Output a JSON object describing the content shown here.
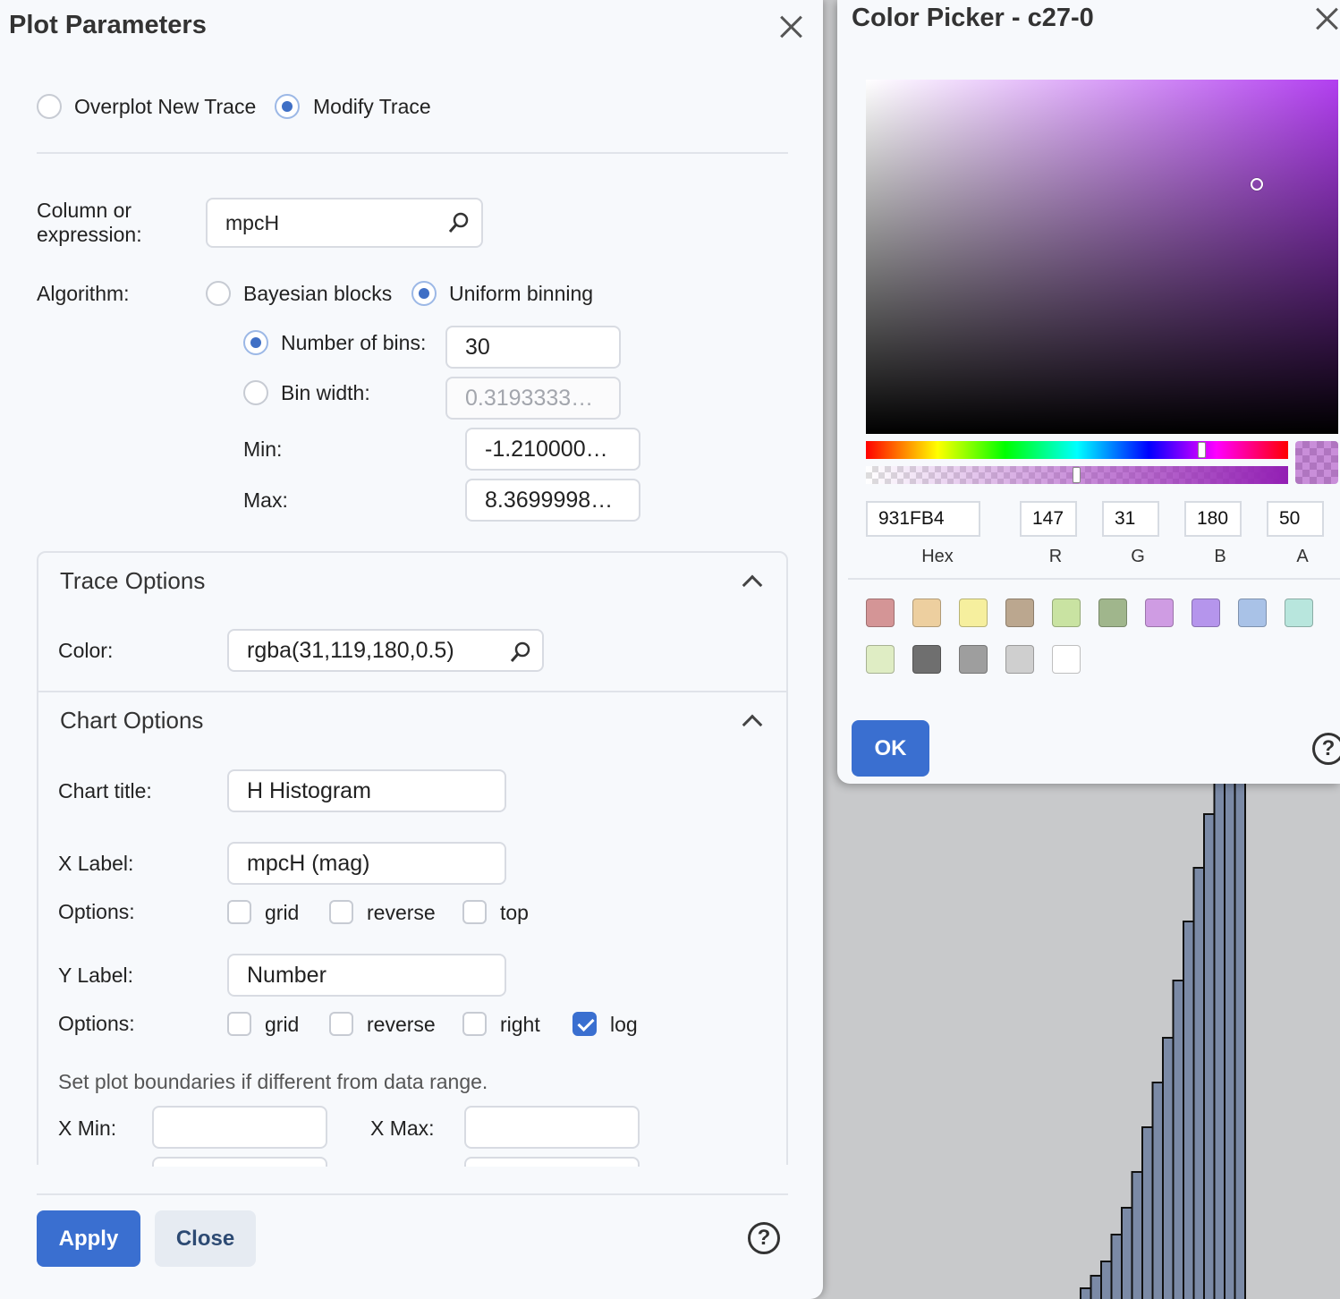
{
  "plot_dialog": {
    "title": "Plot Parameters",
    "mode_options": [
      "Overplot New Trace",
      "Modify Trace"
    ],
    "mode_selected": "Modify Trace",
    "column_label_line1": "Column or",
    "column_label_line2": "expression:",
    "column_value": "mpcH",
    "algorithm_label": "Algorithm:",
    "algorithm_options": [
      "Bayesian blocks",
      "Uniform binning"
    ],
    "algorithm_selected": "Uniform binning",
    "num_bins_label": "Number of bins:",
    "num_bins_value": "30",
    "bin_width_label": "Bin width:",
    "bin_width_value": "0.3193333…",
    "min_label": "Min:",
    "min_value": "-1.210000…",
    "max_label": "Max:",
    "max_value": "8.3699998…",
    "trace_options": {
      "title": "Trace Options",
      "color_label": "Color:",
      "color_value": "rgba(31,119,180,0.5)"
    },
    "chart_options": {
      "title": "Chart Options",
      "chart_title_label": "Chart title:",
      "chart_title_value": "H Histogram",
      "x_label_label": "X Label:",
      "x_label_value": "mpcH (mag)",
      "options_label": "Options:",
      "x_options": [
        {
          "label": "grid",
          "checked": false
        },
        {
          "label": "reverse",
          "checked": false
        },
        {
          "label": "top",
          "checked": false
        }
      ],
      "y_label_label": "Y Label:",
      "y_label_value": "Number",
      "y_options": [
        {
          "label": "grid",
          "checked": false
        },
        {
          "label": "reverse",
          "checked": false
        },
        {
          "label": "right",
          "checked": false
        },
        {
          "label": "log",
          "checked": true
        }
      ],
      "boundaries_note": "Set plot boundaries if different from data range.",
      "x_min_label": "X Min:",
      "x_max_label": "X Max:",
      "x_min_value": "",
      "x_max_value": ""
    },
    "apply_label": "Apply",
    "close_label": "Close",
    "help_glyph": "?"
  },
  "color_picker": {
    "title": "Color Picker - c27-0",
    "hex": "931FB4",
    "r": "147",
    "g": "31",
    "b": "180",
    "a": "50",
    "captions": [
      "Hex",
      "R",
      "G",
      "B",
      "A"
    ],
    "selected_color": "#931FB4",
    "swatches_row1": [
      "#d49596",
      "#edcf9f",
      "#f6ef9e",
      "#bba78f",
      "#c9e3a2",
      "#a0b68c",
      "#cf9ce3",
      "#b595ec",
      "#a9c2e7",
      "#b8e6dd"
    ],
    "swatches_row2": [
      "#dfedc4",
      "#6f6f6f",
      "#9e9e9e",
      "#cfcfcf",
      "#ffffff"
    ],
    "ok_label": "OK",
    "help_glyph": "?"
  },
  "background_histogram": {
    "bar_color": "#7b8aa6",
    "bar_count": 16
  }
}
